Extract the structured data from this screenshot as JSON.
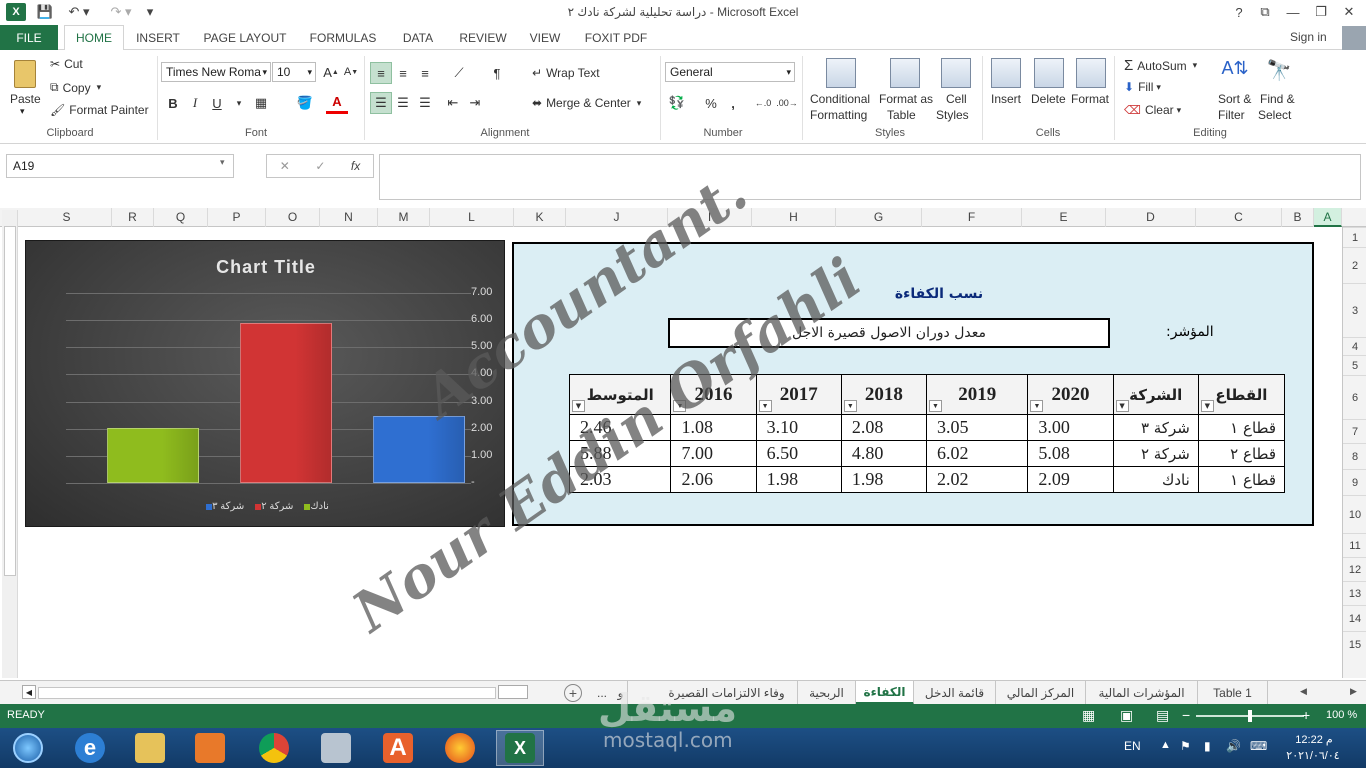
{
  "window": {
    "title": "دراسة تحليلية لشركة نادك ٢ - Microsoft Excel",
    "help": "?",
    "minimize": "—",
    "restore": "❐",
    "close": "✕"
  },
  "ribbon_tabs": [
    "FILE",
    "HOME",
    "INSERT",
    "PAGE LAYOUT",
    "FORMULAS",
    "DATA",
    "REVIEW",
    "VIEW",
    "FOXIT PDF"
  ],
  "sign_in": "Sign in",
  "clipboard": {
    "paste": "Paste",
    "cut": "Cut",
    "copy": "Copy",
    "format_painter": "Format Painter",
    "label": "Clipboard"
  },
  "font": {
    "name": "Times New Roma",
    "size": "10",
    "label": "Font",
    "bold": "B",
    "italic": "I",
    "underline": "U"
  },
  "alignment": {
    "wrap": "Wrap Text",
    "merge": "Merge & Center",
    "label": "Alignment"
  },
  "number": {
    "format": "General",
    "label": "Number",
    "percent": "%",
    "comma": ","
  },
  "styles": {
    "cond": "Conditional",
    "cond2": "Formatting",
    "fat": "Format as",
    "fat2": "Table",
    "cell": "Cell",
    "cell2": "Styles",
    "label": "Styles"
  },
  "cells": {
    "insert": "Insert",
    "delete": "Delete",
    "format": "Format",
    "label": "Cells"
  },
  "editing": {
    "autosum": "AutoSum",
    "fill": "Fill",
    "clear": "Clear",
    "sort": "Sort &",
    "sort2": "Filter",
    "find": "Find &",
    "find2": "Select",
    "label": "Editing"
  },
  "formula_bar": {
    "name_box": "A19",
    "fx": "fx",
    "cancel": "✕",
    "enter": "✓",
    "formula": ""
  },
  "columns": [
    "S",
    "R",
    "Q",
    "P",
    "O",
    "N",
    "M",
    "L",
    "K",
    "J",
    "I",
    "H",
    "G",
    "F",
    "E",
    "D",
    "C",
    "B",
    "A"
  ],
  "rows": [
    "1",
    "2",
    "3",
    "4",
    "5",
    "6",
    "7",
    "8",
    "9",
    "10",
    "11",
    "12",
    "13",
    "14",
    "15"
  ],
  "chart_data": {
    "type": "bar",
    "title": "Chart Title",
    "categories": [
      "نادك",
      "شركة ٢",
      "شركة ٣"
    ],
    "values": [
      2.03,
      5.88,
      2.46
    ],
    "colors": [
      "#8fbc1e",
      "#d13434",
      "#2f6fd1"
    ],
    "ylim": [
      0,
      7
    ],
    "yticks": [
      "7.00",
      "6.00",
      "5.00",
      "4.00",
      "3.00",
      "2.00",
      "1.00",
      "-"
    ],
    "legend_position": "bottom",
    "legend": [
      "نادك",
      "شركة ٢",
      "شركة ٣"
    ]
  },
  "panel": {
    "title": "نسب الكفاءة",
    "indicator_label": "المؤشر:",
    "indicator_value": "معدل دوران الاصول قصيرة الاجل",
    "headers": [
      "القطاع",
      "الشركة",
      "2020",
      "2019",
      "2018",
      "2017",
      "2016",
      "المتوسط"
    ],
    "rows": [
      [
        "قطاع ١",
        "شركة ٣",
        "3.00",
        "3.05",
        "2.08",
        "3.10",
        "1.08",
        "2.46"
      ],
      [
        "قطاع ٢",
        "شركة ٢",
        "5.08",
        "6.02",
        "4.80",
        "6.50",
        "7.00",
        "5.88"
      ],
      [
        "قطاع ١",
        "نادك",
        "2.09",
        "2.02",
        "1.98",
        "1.98",
        "2.06",
        "2.03"
      ]
    ]
  },
  "watermark": {
    "line1": "Accountant.",
    "line2": "Nour Eddin Orfahli"
  },
  "sheet_tabs": [
    "Table 1",
    "المؤشرات المالية",
    "المركز المالي",
    "قائمة الدخل",
    "الكفاءة",
    "الربحية",
    "وفاء الالتزامات القصيرة",
    "...",
    "و"
  ],
  "active_sheet": "الكفاءة",
  "status": {
    "ready": "READY",
    "zoom": "100 %"
  },
  "taskbar": {
    "lang": "EN",
    "time": "12:22 م",
    "date": "٢٠٢١/٠٦/٠٤"
  },
  "mostaql": {
    "arabic": "مستقل",
    "latin": "mostaql.com"
  }
}
